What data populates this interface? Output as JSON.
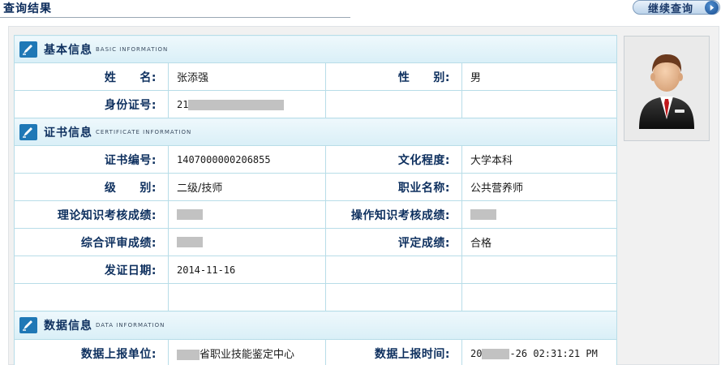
{
  "header": {
    "title": "查询结果",
    "continue_label": "继续查询"
  },
  "basic": {
    "title": "基本信息",
    "title_en": "BASIC INFORMATION",
    "name_label": "姓　　名:",
    "name": "张添强",
    "gender_label": "性　　别:",
    "gender": "男",
    "id_label": "身份证号:",
    "id_prefix": "21"
  },
  "certificate": {
    "title": "证书信息",
    "title_en": "CERTIFICATE INFORMATION",
    "cert_no_label": "证书编号:",
    "cert_no": "1407000000206855",
    "education_label": "文化程度:",
    "education": "大学本科",
    "level_label": "级　　别:",
    "level": "二级/技师",
    "occupation_label": "职业名称:",
    "occupation": "公共营养师",
    "theory_label": "理论知识考核成绩:",
    "operation_label": "操作知识考核成绩:",
    "review_label": "综合评审成绩:",
    "rating_label": "评定成绩:",
    "rating": "合格",
    "issue_date_label": "发证日期:",
    "issue_date": "2014-11-16"
  },
  "data_info": {
    "title": "数据信息",
    "title_en": "DATA INFORMATION",
    "unit_label": "数据上报单位:",
    "unit_suffix": "省职业技能鉴定中心",
    "time_label": "数据上报时间:",
    "time_prefix": "20",
    "time_suffix": "-26 02:31:21 PM"
  },
  "icons": {
    "section": "pen-icon",
    "continue": "arrow-right-icon",
    "photo": "person-avatar-icon"
  },
  "colors": {
    "label": "#0d2f5e",
    "section_icon": "#1f78b6",
    "cell_border": "#b8dde8",
    "mask": "#c2c2c2"
  }
}
